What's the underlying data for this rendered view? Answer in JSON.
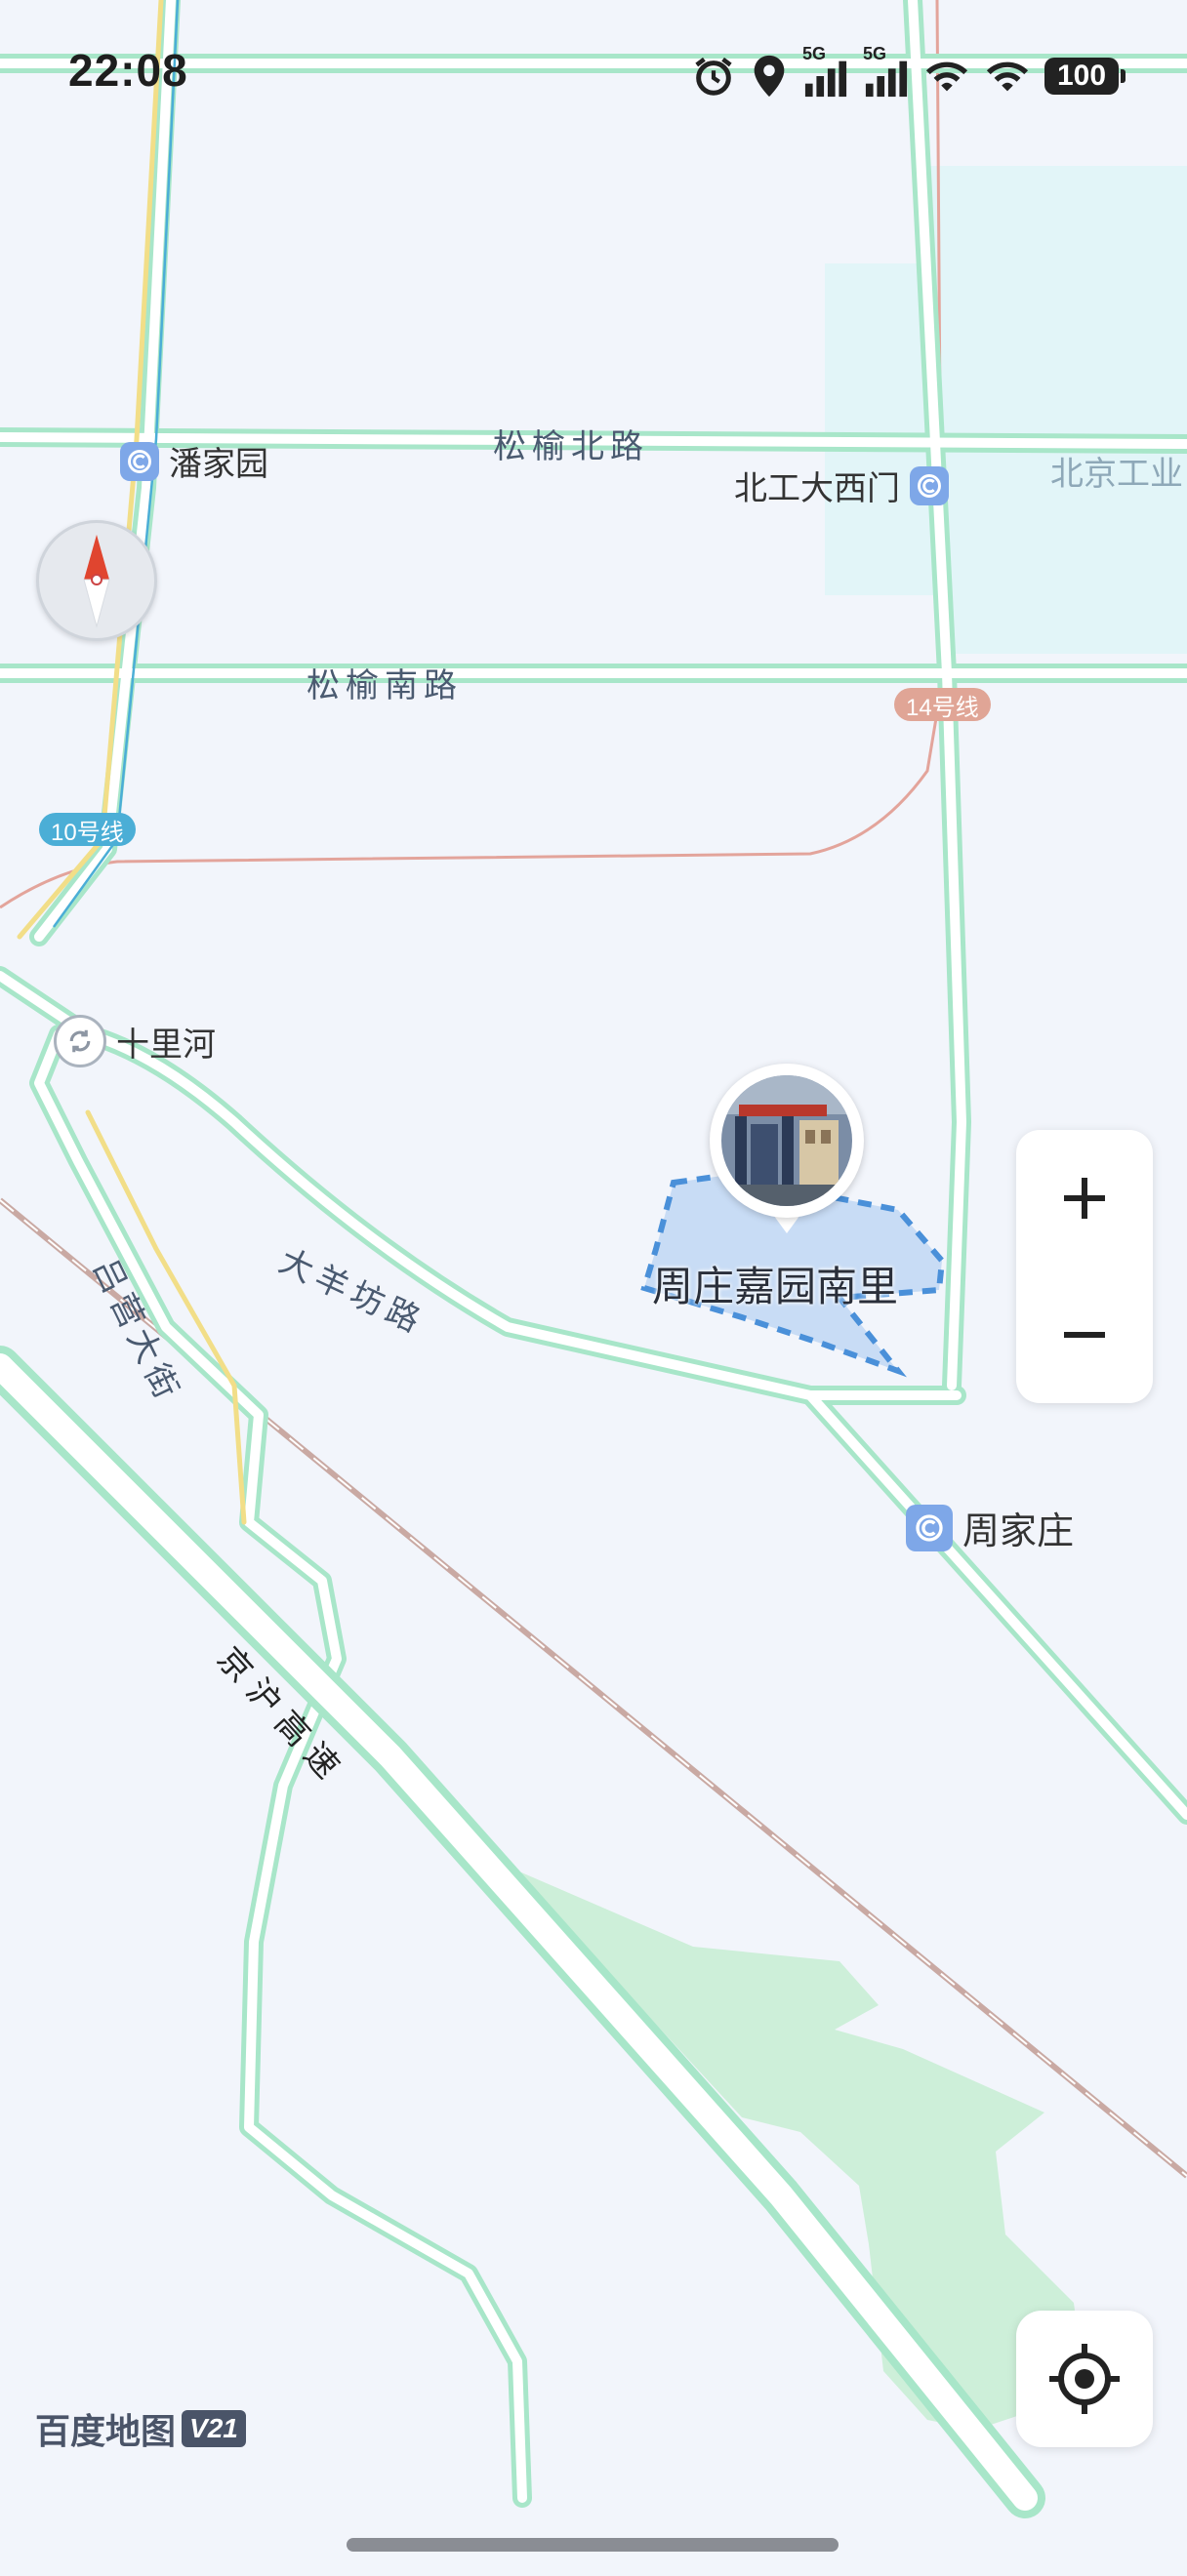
{
  "status_bar": {
    "time": "22:08",
    "icons": [
      "alarm-icon",
      "location-icon",
      "signal-5g-icon",
      "signal-5g-icon",
      "wifi-icon",
      "wifi-icon"
    ],
    "network_label_1": "5G",
    "network_label_2": "5G",
    "battery": "100"
  },
  "map": {
    "roads": {
      "songyu_north": "松榆北路",
      "songyu_south": "松榆南路",
      "dayangfang": "大羊坊路",
      "lvying": "吕营大街",
      "jinghu": "京沪高速"
    },
    "stations": {
      "panjiayuan": "潘家园",
      "beigong_daximen": "北工大西门",
      "zhoujiazhuang": "周家庄"
    },
    "places": {
      "beijing_gongye": "北京工业",
      "shilihe": "十里河"
    },
    "subway_badges": {
      "line10": "10号线",
      "line14": "14号线"
    },
    "colors": {
      "background": "#f2f5fb",
      "road_outline": "#a8e6c9",
      "green_area": "#cdefd9",
      "campus_area": "#e2f5f8",
      "line10": "#4baed6",
      "line14": "#e0a596",
      "poi_boundary": "#4a90d9"
    }
  },
  "poi": {
    "name": "周庄嘉园南里"
  },
  "controls": {
    "zoom_in": "+",
    "zoom_out": "−"
  },
  "logo": {
    "text": "百度地图",
    "badge": "V21"
  }
}
